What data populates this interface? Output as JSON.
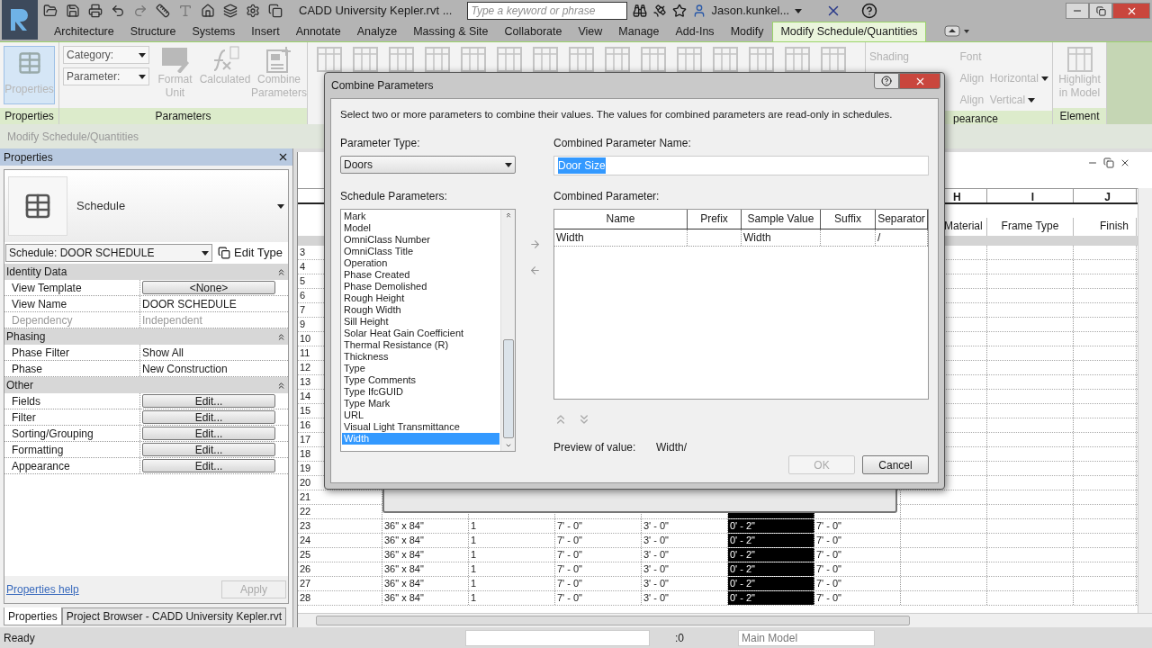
{
  "app": {
    "title": "CADD University Kepler.rvt ...",
    "search_placeholder": "Type a keyword or phrase",
    "user": "Jason.kunkel..."
  },
  "ribbon_tabs": [
    {
      "label": "Architecture",
      "selected": false
    },
    {
      "label": "Structure",
      "selected": false
    },
    {
      "label": "Systems",
      "selected": false
    },
    {
      "label": "Insert",
      "selected": false
    },
    {
      "label": "Annotate",
      "selected": false
    },
    {
      "label": "Analyze",
      "selected": false
    },
    {
      "label": "Massing & Site",
      "selected": false
    },
    {
      "label": "Collaborate",
      "selected": false
    },
    {
      "label": "View",
      "selected": false
    },
    {
      "label": "Manage",
      "selected": false
    },
    {
      "label": "Add-Ins",
      "selected": false
    },
    {
      "label": "Modify",
      "selected": false
    },
    {
      "label": "Modify Schedule/Quantities",
      "selected": true
    }
  ],
  "ribbon": {
    "properties_panel": {
      "label": "Properties",
      "button": {
        "label": "Properties",
        "selected": true
      }
    },
    "parameters_panel": {
      "label": "Parameters",
      "category_placeholder": "Category:",
      "parameter_placeholder": "Parameter:",
      "buttons": [
        {
          "label": "Format Unit",
          "kind": "format",
          "disabled": true
        },
        {
          "label": "Calculated",
          "kind": "formula",
          "disabled": true
        },
        {
          "label": "Combine Parameters",
          "kind": "combine",
          "disabled": true
        }
      ]
    },
    "appearance_panel": {
      "label": "pearance",
      "items": [
        {
          "label": "Shading",
          "kind": "shading",
          "disabled": true
        },
        {
          "label": "Font",
          "kind": "font",
          "disabled": true
        },
        {
          "label": "Align  Horizontal",
          "kind": "align",
          "disabled": true
        },
        {
          "label": "Align  Vertical",
          "kind": "align",
          "disabled": true
        }
      ]
    },
    "element_panel": {
      "label": "Element",
      "button": {
        "label": "Highlight in Model",
        "disabled": true
      }
    }
  },
  "options_bar": "Modify Schedule/Quantities",
  "properties": {
    "title": "Properties",
    "type_name": "Schedule",
    "instance": "Schedule: DOOR SCHEDULE",
    "edit_type": "Edit Type",
    "groups": [
      {
        "name": "Identity Data",
        "expanded": true,
        "rows": [
          {
            "label": "View Template",
            "value": "<None>",
            "kind": "button",
            "disabled": false
          },
          {
            "label": "View Name",
            "value": "DOOR SCHEDULE",
            "kind": "text",
            "disabled": false
          },
          {
            "label": "Dependency",
            "value": "Independent",
            "kind": "text",
            "disabled": true
          }
        ]
      },
      {
        "name": "Phasing",
        "expanded": true,
        "rows": [
          {
            "label": "Phase Filter",
            "value": "Show All",
            "kind": "text",
            "disabled": false
          },
          {
            "label": "Phase",
            "value": "New Construction",
            "kind": "text",
            "disabled": false
          }
        ]
      },
      {
        "name": "Other",
        "expanded": true,
        "rows": [
          {
            "label": "Fields",
            "value": "Edit...",
            "kind": "button",
            "disabled": false
          },
          {
            "label": "Filter",
            "value": "Edit...",
            "kind": "button",
            "disabled": false
          },
          {
            "label": "Sorting/Grouping",
            "value": "Edit...",
            "kind": "button",
            "disabled": false
          },
          {
            "label": "Formatting",
            "value": "Edit...",
            "kind": "button",
            "disabled": false
          },
          {
            "label": "Appearance",
            "value": "Edit...",
            "kind": "button",
            "disabled": false
          }
        ]
      }
    ],
    "help_link": "Properties help",
    "apply": {
      "label": "Apply",
      "disabled": true
    }
  },
  "bottom_tabs": [
    {
      "label": "Properties",
      "selected": true
    },
    {
      "label": "Project Browser - CADD University Kepler.rvt",
      "selected": false
    }
  ],
  "schedule": {
    "columns": [
      {
        "selected": false
      },
      {
        "selected": false
      },
      {
        "selected": false
      },
      {
        "selected": false
      },
      {
        "selected": false
      },
      {
        "selected": true
      },
      {
        "selected": false
      },
      {
        "letter": "H",
        "name": "Material",
        "selected": false
      },
      {
        "letter": "I",
        "name": "Frame Type",
        "selected": false
      },
      {
        "letter": "J",
        "name": "Finish",
        "selected": false
      }
    ],
    "rows": [
      {
        "cells": [
          "3"
        ]
      },
      {
        "cells": [
          "4"
        ]
      },
      {
        "cells": [
          "5"
        ]
      },
      {
        "cells": [
          "6"
        ]
      },
      {
        "cells": [
          "7"
        ]
      },
      {
        "cells": [
          "9"
        ]
      },
      {
        "cells": [
          "10"
        ]
      },
      {
        "cells": [
          "11"
        ]
      },
      {
        "cells": [
          "12"
        ]
      },
      {
        "cells": [
          "13"
        ]
      },
      {
        "cells": [
          "14"
        ]
      },
      {
        "cells": [
          "15"
        ]
      },
      {
        "cells": [
          "16"
        ]
      },
      {
        "cells": [
          "17"
        ]
      },
      {
        "cells": [
          "18"
        ]
      },
      {
        "cells": [
          "19"
        ]
      },
      {
        "cells": [
          "20"
        ]
      },
      {
        "cells": [
          "21"
        ]
      },
      {
        "cells": [
          "22"
        ]
      },
      {
        "cells": [
          "23",
          "36\" x 84\"",
          "1",
          "7' - 0\"",
          "3' - 0\"",
          "0' - 2\"",
          "7' - 0\""
        ]
      },
      {
        "cells": [
          "24",
          "36\" x 84\"",
          "1",
          "7' - 0\"",
          "3' - 0\"",
          "0' - 2\"",
          "7' - 0\""
        ]
      },
      {
        "cells": [
          "25",
          "36\" x 84\"",
          "1",
          "7' - 0\"",
          "3' - 0\"",
          "0' - 2\"",
          "7' - 0\""
        ]
      },
      {
        "cells": [
          "26",
          "36\" x 84\"",
          "1",
          "7' - 0\"",
          "3' - 0\"",
          "0' - 2\"",
          "7' - 0\""
        ]
      },
      {
        "cells": [
          "27",
          "36\" x 84\"",
          "1",
          "7' - 0\"",
          "3' - 0\"",
          "0' - 2\"",
          "7' - 0\""
        ]
      },
      {
        "cells": [
          "28",
          "36\" x 84\"",
          "1",
          "7' - 0\"",
          "3' - 0\"",
          "0' - 2\"",
          "7' - 0\""
        ]
      }
    ]
  },
  "dialog": {
    "title": "Combine Parameters",
    "instruction": "Select two or more parameters to combine their values.  The values for combined parameters are read-only in schedules.",
    "parameter_type_label": "Parameter Type:",
    "parameter_type": "Doors",
    "name_label": "Combined Parameter Name:",
    "name_value": "Door Size",
    "name_highlighted": true,
    "list_label": "Schedule Parameters:",
    "parameters": [
      {
        "label": "Mark",
        "selected": false
      },
      {
        "label": "Model",
        "selected": false
      },
      {
        "label": "OmniClass Number",
        "selected": false
      },
      {
        "label": "OmniClass Title",
        "selected": false
      },
      {
        "label": "Operation",
        "selected": false
      },
      {
        "label": "Phase Created",
        "selected": false
      },
      {
        "label": "Phase Demolished",
        "selected": false
      },
      {
        "label": "Rough Height",
        "selected": false
      },
      {
        "label": "Rough Width",
        "selected": false
      },
      {
        "label": "Sill Height",
        "selected": false
      },
      {
        "label": "Solar Heat Gain Coefficient",
        "selected": false
      },
      {
        "label": "Thermal Resistance (R)",
        "selected": false
      },
      {
        "label": "Thickness",
        "selected": false
      },
      {
        "label": "Type",
        "selected": false
      },
      {
        "label": "Type Comments",
        "selected": false
      },
      {
        "label": "Type IfcGUID",
        "selected": false
      },
      {
        "label": "Type Mark",
        "selected": false
      },
      {
        "label": "URL",
        "selected": false
      },
      {
        "label": "Visual Light Transmittance",
        "selected": false
      },
      {
        "label": "Width",
        "selected": true
      }
    ],
    "table_label": "Combined Parameter:",
    "table_columns": [
      "Name",
      "Prefix",
      "Sample Value",
      "Suffix",
      "Separator"
    ],
    "table_rows": [
      [
        "Width",
        "",
        "Width",
        "",
        "/"
      ]
    ],
    "preview_label": "Preview of value:",
    "preview_value": "Width/",
    "buttons": [
      {
        "label": "OK",
        "disabled": true
      },
      {
        "label": "Cancel",
        "disabled": false
      }
    ]
  },
  "status_bar": {
    "text": "Ready",
    "count": ":0",
    "model": "Main Model"
  }
}
